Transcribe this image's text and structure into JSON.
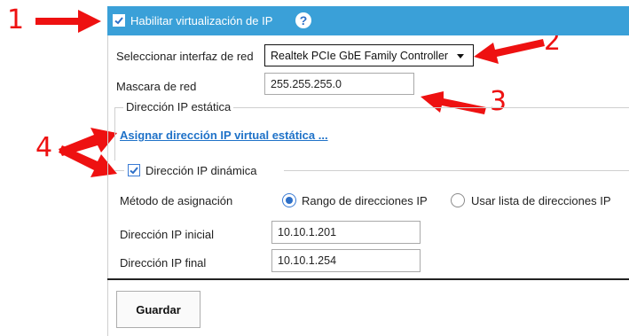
{
  "annotations": {
    "n1": "1",
    "n2": "2",
    "n3": "3",
    "n4": "4",
    "color": "#ee1111"
  },
  "header": {
    "checkbox_checked": true,
    "title": "Habilitar virtualización de IP",
    "help": "?"
  },
  "network": {
    "interface_label": "Seleccionar interfaz de red",
    "interface_value": "Realtek PCIe GbE Family Controller",
    "mask_label": "Mascara de red",
    "mask_value": "255.255.255.0"
  },
  "static_ip": {
    "legend": "Dirección IP estática",
    "assign_link": "Asignar dirección IP virtual estática ..."
  },
  "dynamic_ip": {
    "checkbox_checked": true,
    "legend": "Dirección IP dinámica",
    "method_label": "Método de asignación",
    "option_range": "Rango de direcciones IP",
    "option_list": "Usar lista de direcciones IP",
    "selected_option": "Rango de direcciones IP",
    "start_label": "Dirección IP inicial",
    "start_value": "10.10.1.201",
    "end_label": "Dirección IP final",
    "end_value": "10.10.1.254"
  },
  "actions": {
    "save_label": "Guardar"
  },
  "colors": {
    "header_bg": "#3aa0d8",
    "accent": "#2d6fc7",
    "link": "#1f72c8"
  }
}
